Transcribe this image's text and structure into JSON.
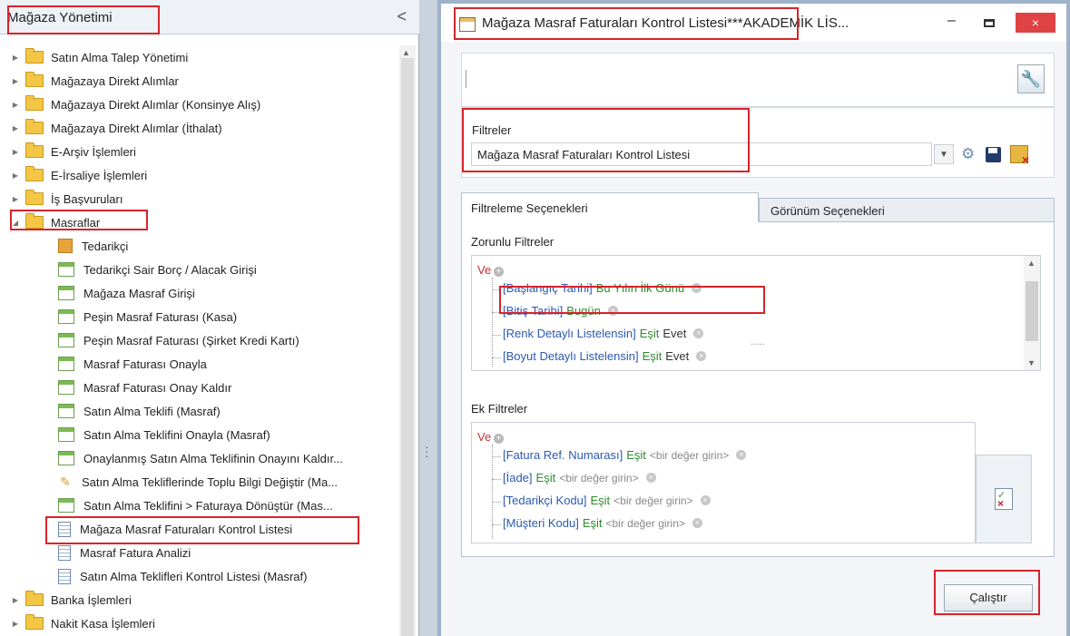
{
  "left_panel": {
    "title": "Mağaza Yönetimi",
    "collapse_glyph": "<",
    "tree": [
      {
        "label": "Satın Alma Talep Yönetimi",
        "icon": "folder-icon",
        "level": 0,
        "expander": "collapsed"
      },
      {
        "label": "Mağazaya Direkt Alımlar",
        "icon": "folder-icon",
        "level": 0,
        "expander": "collapsed"
      },
      {
        "label": "Mağazaya Direkt Alımlar (Konsinye Alış)",
        "icon": "folder-icon",
        "level": 0,
        "expander": "collapsed"
      },
      {
        "label": "Mağazaya Direkt Alımlar (İthalat)",
        "icon": "folder-icon",
        "level": 0,
        "expander": "collapsed"
      },
      {
        "label": "E-Arşiv İşlemleri",
        "icon": "folder-icon",
        "level": 0,
        "expander": "collapsed"
      },
      {
        "label": "E-İrsaliye İşlemleri",
        "icon": "folder-icon",
        "level": 0,
        "expander": "collapsed"
      },
      {
        "label": "İş Başvuruları",
        "icon": "folder-icon",
        "level": 0,
        "expander": "collapsed"
      },
      {
        "label": "Masraflar",
        "icon": "folder-icon",
        "level": 0,
        "expander": "expanded"
      },
      {
        "label": "Tedarikçi",
        "icon": "supplier-icon",
        "level": 1
      },
      {
        "label": "Tedarikçi Sair Borç / Alacak Girişi",
        "icon": "form-icon",
        "level": 1
      },
      {
        "label": "Mağaza Masraf Girişi",
        "icon": "form-icon",
        "level": 1
      },
      {
        "label": "Peşin Masraf Faturası (Kasa)",
        "icon": "form-icon",
        "level": 1
      },
      {
        "label": "Peşin Masraf Faturası (Şirket Kredi Kartı)",
        "icon": "form-icon",
        "level": 1
      },
      {
        "label": "Masraf Faturası Onayla",
        "icon": "form-icon",
        "level": 1
      },
      {
        "label": "Masraf Faturası Onay Kaldır",
        "icon": "form-icon",
        "level": 1
      },
      {
        "label": "Satın Alma Teklifi (Masraf)",
        "icon": "form-icon",
        "level": 1
      },
      {
        "label": "Satın Alma Teklifini Onayla (Masraf)",
        "icon": "form-icon",
        "level": 1
      },
      {
        "label": "Onaylanmış Satın Alma Teklifinin Onayını Kaldır...",
        "icon": "form-icon",
        "level": 1
      },
      {
        "label": "Satın Alma Tekliflerinde Toplu Bilgi Değiştir (Ma...",
        "icon": "bulk-edit-icon",
        "level": 1
      },
      {
        "label": "Satın Alma Teklifini > Faturaya Dönüştür (Mas...",
        "icon": "form-icon",
        "level": 1
      },
      {
        "label": "Mağaza Masraf Faturaları Kontrol Listesi",
        "icon": "list-icon",
        "level": 1
      },
      {
        "label": "Masraf Fatura Analizi",
        "icon": "list-icon",
        "level": 1
      },
      {
        "label": "Satın Alma Teklifleri Kontrol Listesi (Masraf)",
        "icon": "list-icon",
        "level": 1
      },
      {
        "label": "Banka İşlemleri",
        "icon": "folder-icon",
        "level": 0,
        "expander": "collapsed"
      },
      {
        "label": "Nakit Kasa İşlemleri",
        "icon": "folder-icon",
        "level": 0,
        "expander": "collapsed"
      }
    ]
  },
  "window": {
    "title": "Mağaza Masraf Faturaları Kontrol Listesi***AKADEMİK LİS...",
    "minimize": "–",
    "close": "×"
  },
  "filters": {
    "label": "Filtreler",
    "selected": "Mağaza Masraf Faturaları Kontrol Listesi"
  },
  "tabs": {
    "filtering": "Filtreleme Seçenekleri",
    "view": "Görünüm Seçenekleri"
  },
  "required_filters": {
    "label": "Zorunlu Filtreler",
    "conjunction": "Ve",
    "rows": [
      {
        "field": "[Başlangıç Tarihi]",
        "op": "",
        "value": "Bu Yılın İlk Günü",
        "value_green": true
      },
      {
        "field": "[Bitiş Tarihi]",
        "op": "",
        "value": "Bugün",
        "value_green": true
      },
      {
        "field": "[Renk Detaylı Listelensin]",
        "op": "Eşit",
        "value": "Evet",
        "value_green": false
      },
      {
        "field": "[Boyut Detaylı Listelensin]",
        "op": "Eşit",
        "value": "Evet",
        "value_green": false
      }
    ],
    "resize_dots": "....."
  },
  "additional_filters": {
    "label": "Ek Filtreler",
    "conjunction": "Ve",
    "rows": [
      {
        "field": "[Fatura Ref. Numarası]",
        "op": "Eşit",
        "placeholder": "<bir değer girin>"
      },
      {
        "field": "[İade]",
        "op": "Eşit",
        "placeholder": "<bir değer girin>"
      },
      {
        "field": "[Tedarikçi Kodu]",
        "op": "Eşit",
        "placeholder": "<bir değer girin>"
      },
      {
        "field": "[Müşteri Kodu]",
        "op": "Eşit",
        "placeholder": "<bir değer girin>"
      }
    ]
  },
  "run_button": "Çalıştır",
  "accent": {
    "highlight": "#d8232a",
    "close": "#e04343"
  }
}
